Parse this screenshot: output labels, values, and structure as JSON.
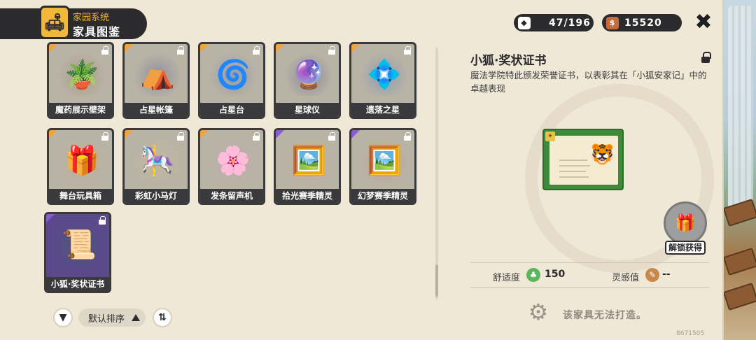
{
  "header": {
    "subtitle": "家园系统",
    "title": "家具图鉴",
    "icon": "sofa-icon"
  },
  "counters": {
    "collection": {
      "value": "47/196",
      "icon": "furniture-box-icon"
    },
    "currency": {
      "value": "15520",
      "icon": "coin-bag-icon"
    }
  },
  "close_label": "✖",
  "grid": {
    "items": [
      {
        "name": "魔药展示壁架",
        "emoji": "🪴",
        "rarity": "orange"
      },
      {
        "name": "占星帐篷",
        "emoji": "⛺",
        "rarity": "orange"
      },
      {
        "name": "占星台",
        "emoji": "🌀",
        "rarity": "orange"
      },
      {
        "name": "星球仪",
        "emoji": "🔮",
        "rarity": "orange"
      },
      {
        "name": "遗落之星",
        "emoji": "💠",
        "rarity": "orange"
      },
      {
        "name": "舞台玩具箱",
        "emoji": "🎁",
        "rarity": "orange"
      },
      {
        "name": "彩虹小马灯",
        "emoji": "🎠",
        "rarity": "orange"
      },
      {
        "name": "发条留声机",
        "emoji": "🌸",
        "rarity": "orange"
      },
      {
        "name": "拾光赛季精灵",
        "emoji": "🖼️",
        "rarity": "purple"
      },
      {
        "name": "幻梦赛季精灵",
        "emoji": "🖼️",
        "rarity": "purple"
      },
      {
        "name": "小狐·奖状证书",
        "emoji": "📜",
        "rarity": "purple"
      }
    ]
  },
  "controls": {
    "filter_icon": "filter-icon",
    "sort_label": "默认排序",
    "swap_icon": "sort-swap-icon"
  },
  "detail": {
    "name": "小狐·奖状证书",
    "description": "魔法学院特此颁发荣誉证书，以表彰其在「小狐安家记」中的卓越表现",
    "unlock_label": "解锁获得",
    "comfort_label": "舒适度",
    "comfort_value": "150",
    "inspiration_label": "灵感值",
    "inspiration_value": "--",
    "craft_note": "该家具无法打造。"
  },
  "uid": "8671505",
  "colors": {
    "orange_corner": "#f2a33a",
    "purple_corner": "#8b5bd6",
    "dark": "#2b2a2c"
  }
}
